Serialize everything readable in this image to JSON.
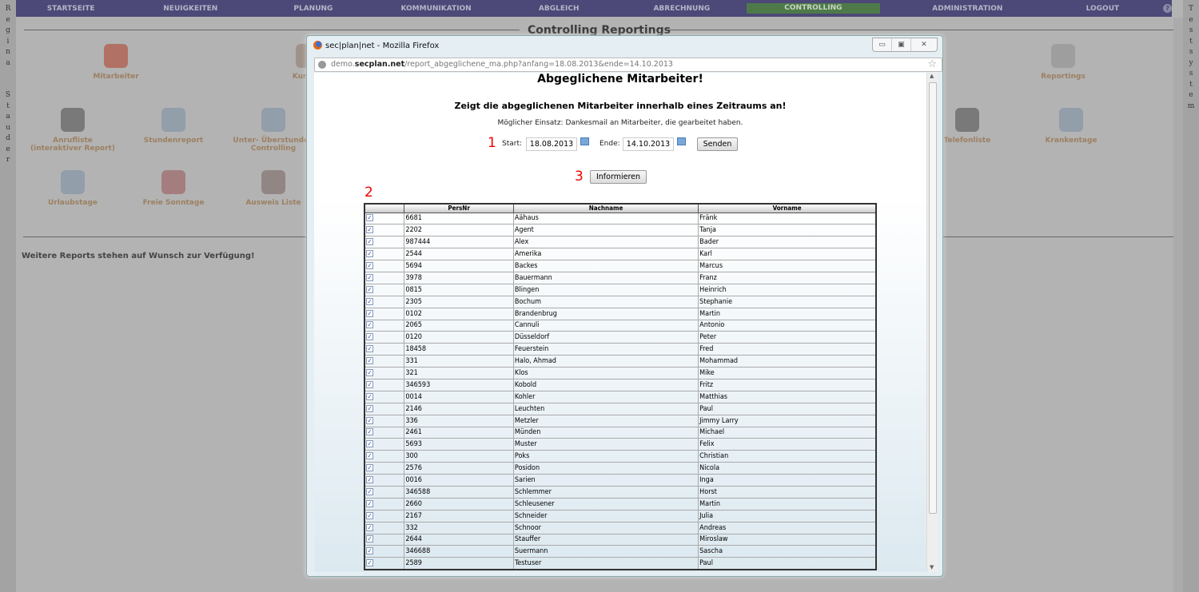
{
  "user_name_vertical": "Regina Stauder",
  "system_vertical": "Testsystem",
  "nav": [
    "STARTSEITE",
    "NEUIGKEITEN",
    "PLANUNG",
    "KOMMUNIKATION",
    "ABGLEICH",
    "ABRECHNUNG",
    "CONTROLLING",
    "ADMINISTRATION",
    "LOGOUT"
  ],
  "nav_active": "CONTROLLING",
  "section_title": "Controlling Reportings",
  "tiles": {
    "mitarbeiter": "Mitarbeiter",
    "kunden": "Kunden",
    "reportings": "Reportings",
    "anrufliste1": "Anrufliste",
    "anrufliste2": "(interaktiver Report)",
    "stundenreport": "Stundenreport",
    "ueber1": "Unter- Überstunden",
    "ueber2": "Controlling",
    "telefonliste": "Telefonliste",
    "krankentage": "Krankentage",
    "urlaubstage": "Urlaubstage",
    "freie_sonntage": "Freie Sonntage",
    "ausweis": "Ausweis Liste"
  },
  "more_reports": "Weitere Reports stehen auf Wunsch zur Verfügung!",
  "popup": {
    "window_title": "sec|plan|net - Mozilla Firefox",
    "url_host_pre": "demo.",
    "url_host_bold": "secplan.net",
    "url_path": "/report_abgeglichene_ma.php?anfang=18.08.2013&ende=14.10.2013",
    "heading": "Abgeglichene Mitarbeiter!",
    "subheading": "Zeigt die abgeglichenen Mitarbeiter innerhalb eines Zeitraums an!",
    "hint": "Möglicher Einsatz: Dankesmail an Mitarbeiter, die gearbeitet haben.",
    "marker1": "1",
    "marker2": "2",
    "marker3": "3",
    "start_label": "Start:",
    "start_value": "18.08.2013",
    "end_label": "Ende:",
    "end_value": "14.10.2013",
    "send_button": "Senden",
    "inform_button": "Informieren",
    "columns": [
      "",
      "PersNr",
      "Nachname",
      "Vorname"
    ],
    "rows": [
      [
        "6681",
        "Aähaus",
        "Fränk"
      ],
      [
        "2202",
        "Agent",
        "Tanja"
      ],
      [
        "987444",
        "Alex",
        "Bader"
      ],
      [
        "2544",
        "Amerika",
        "Karl"
      ],
      [
        "5694",
        "Backes",
        "Marcus"
      ],
      [
        "3978",
        "Bauermann",
        "Franz"
      ],
      [
        "0815",
        "Blingen",
        "Heinrich"
      ],
      [
        "2305",
        "Bochum",
        "Stephanie"
      ],
      [
        "0102",
        "Brandenbrug",
        "Martin"
      ],
      [
        "2065",
        "Cannuli",
        "Antonio"
      ],
      [
        "0120",
        "Düsseldorf",
        "Peter"
      ],
      [
        "18458",
        "Feuerstein",
        "Fred"
      ],
      [
        "331",
        "Halo, Ahmad",
        "Mohammad"
      ],
      [
        "321",
        "Klos",
        "Mike"
      ],
      [
        "346593",
        "Kobold",
        "Fritz"
      ],
      [
        "0014",
        "Kohler",
        "Matthias"
      ],
      [
        "2146",
        "Leuchten",
        "Paul"
      ],
      [
        "336",
        "Metzler",
        "Jimmy Larry"
      ],
      [
        "2461",
        "Münden",
        "Michael"
      ],
      [
        "5693",
        "Muster",
        "Felix"
      ],
      [
        "300",
        "Poks",
        "Christian"
      ],
      [
        "2576",
        "Posidon",
        "Nicola"
      ],
      [
        "0016",
        "Sarien",
        "Inga"
      ],
      [
        "346588",
        "Schlemmer",
        "Horst"
      ],
      [
        "2660",
        "Schleusener",
        "Martin"
      ],
      [
        "2167",
        "Schneider",
        "Julia"
      ],
      [
        "332",
        "Schnoor",
        "Andreas"
      ],
      [
        "2644",
        "Stauffer",
        "Miroslaw"
      ],
      [
        "346688",
        "Suermann",
        "Sascha"
      ],
      [
        "2589",
        "Testuser",
        "Paul"
      ]
    ],
    "all_checked": true
  }
}
